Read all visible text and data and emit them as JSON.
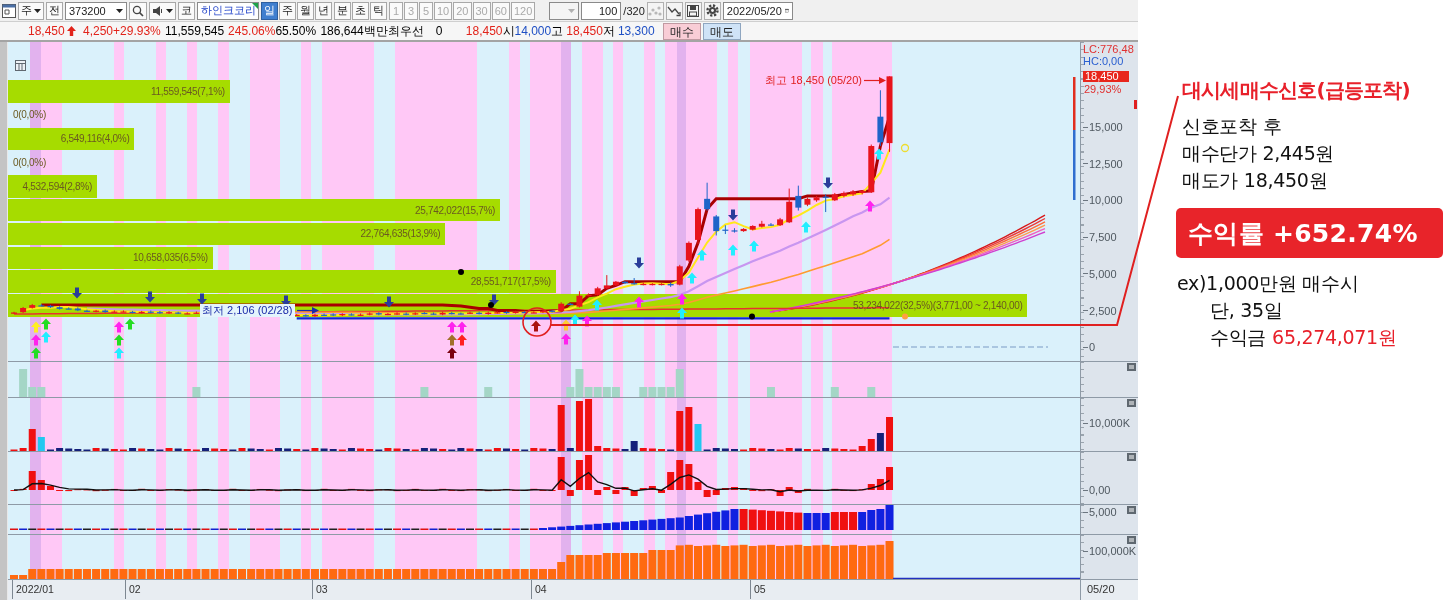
{
  "toolbar": {
    "market_dropdown": {
      "value": "주"
    },
    "all_button": "전",
    "code_field": {
      "value": "373200"
    },
    "prefix_button": "코",
    "stock_name": "하인크코리",
    "period_tabs": [
      {
        "label": "일",
        "selected": true
      },
      {
        "label": "주",
        "selected": false
      },
      {
        "label": "월",
        "selected": false
      },
      {
        "label": "년",
        "selected": false
      }
    ],
    "intraday_tabs": [
      {
        "label": "분",
        "selected": false
      },
      {
        "label": "초",
        "selected": false
      },
      {
        "label": "틱",
        "selected": false
      }
    ],
    "interval_options": [
      {
        "label": "1",
        "disabled": true
      },
      {
        "label": "3",
        "disabled": true
      },
      {
        "label": "5",
        "disabled": true
      },
      {
        "label": "10",
        "disabled": true
      },
      {
        "label": "20",
        "disabled": true
      },
      {
        "label": "30",
        "disabled": true
      },
      {
        "label": "60",
        "disabled": true
      },
      {
        "label": "120",
        "disabled": true
      }
    ],
    "interval_dropdown": {
      "disabled": true
    },
    "count_field": {
      "value": "100",
      "total": "/320"
    },
    "tool_buttons": [
      {
        "kind": "pattern",
        "disabled": true
      },
      {
        "kind": "trend",
        "disabled": false
      },
      {
        "kind": "save",
        "disabled": false
      },
      {
        "kind": "settings",
        "disabled": false
      }
    ],
    "date_field": {
      "value": "2022/05/20"
    }
  },
  "quote_bar": {
    "items": [
      {
        "kind": "price",
        "text": "18,450",
        "color": "#e2231a"
      },
      {
        "kind": "value",
        "text": "4,250",
        "color": "#e2231a"
      },
      {
        "kind": "value",
        "text": "+29.93%",
        "color": "#e2231a"
      },
      {
        "kind": "value",
        "text": "11,559,545"
      },
      {
        "kind": "value",
        "text": "245.06%",
        "color": "#e2231a"
      },
      {
        "kind": "value",
        "text": "65.50%"
      },
      {
        "kind": "value",
        "text": "186,644백만"
      },
      {
        "kind": "label",
        "text": "최우선"
      },
      {
        "kind": "value",
        "text": "0"
      },
      {
        "kind": "value",
        "text": "18,450",
        "color": "#e2231a"
      },
      {
        "kind": "label",
        "text": "시"
      },
      {
        "kind": "value",
        "text": "14,000",
        "color": "#1f4fc4"
      },
      {
        "kind": "label",
        "text": "고"
      },
      {
        "kind": "value",
        "text": "18,450",
        "color": "#e2231a"
      },
      {
        "kind": "label",
        "text": "저"
      },
      {
        "kind": "value",
        "text": "13,300",
        "color": "#1f4fc4"
      }
    ],
    "buttons": [
      {
        "label": "매수",
        "kind": "buy"
      },
      {
        "label": "매도",
        "kind": "sell"
      }
    ]
  },
  "chart": {
    "volume_profile": [
      {
        "label": "11,559,545(7,1%)",
        "level": 0.207
      },
      {
        "label": "0(0,0%)",
        "level": 0
      },
      {
        "label": "6,549,116(4,0%)",
        "level": 0.118
      },
      {
        "label": "0(0,0%)",
        "level": 0
      },
      {
        "label": "4,532,594(2,8%)",
        "level": 0.083
      },
      {
        "label": "25,742,022(15,7%)",
        "level": 0.459
      },
      {
        "label": "22,764,635(13,9%)",
        "level": 0.408
      },
      {
        "label": "10,658,035(6,5%)",
        "level": 0.191
      },
      {
        "label": "28,551,717(17,5%)",
        "level": 0.511
      },
      {
        "label": "53,234,022(32,5%)(3,771,00 ~ 2,140,00)",
        "level": 0.951
      }
    ],
    "high_marker": "최고 18,450 (05/20)",
    "low_marker": "최저 2,106 (02/28)",
    "price_axis": {
      "lc": "LC:776,48",
      "hc": "HC:0,00",
      "last_price": "18,450",
      "last_change": "29,93%",
      "ticks": [
        "15,000",
        "12,500",
        "10,000",
        "7,500",
        "5,000",
        "2,500",
        "0"
      ]
    },
    "indicator_panels": [
      {
        "kind": "signal"
      },
      {
        "kind": "volume",
        "tick": "10,000K"
      },
      {
        "kind": "oscillator",
        "tick": "0,00"
      },
      {
        "kind": "balance",
        "tick": "5,000"
      },
      {
        "kind": "cumulative",
        "tick": "100,000K"
      }
    ],
    "date_axis": {
      "months": [
        "2022/01",
        "02",
        "03",
        "04",
        "05"
      ],
      "current": "05/20"
    }
  },
  "annotation": {
    "title": "대시세매수신호(급등포착)",
    "lines": [
      "신호포착 후",
      "매수단가 2,445원",
      "매도가 18,450원"
    ],
    "return_badge": "수익률 +652.74%",
    "example": "ex)1,000만원 매수시",
    "condition": "단, 35일",
    "profit": {
      "label": "수익금",
      "value": "65,274,071원"
    }
  }
}
